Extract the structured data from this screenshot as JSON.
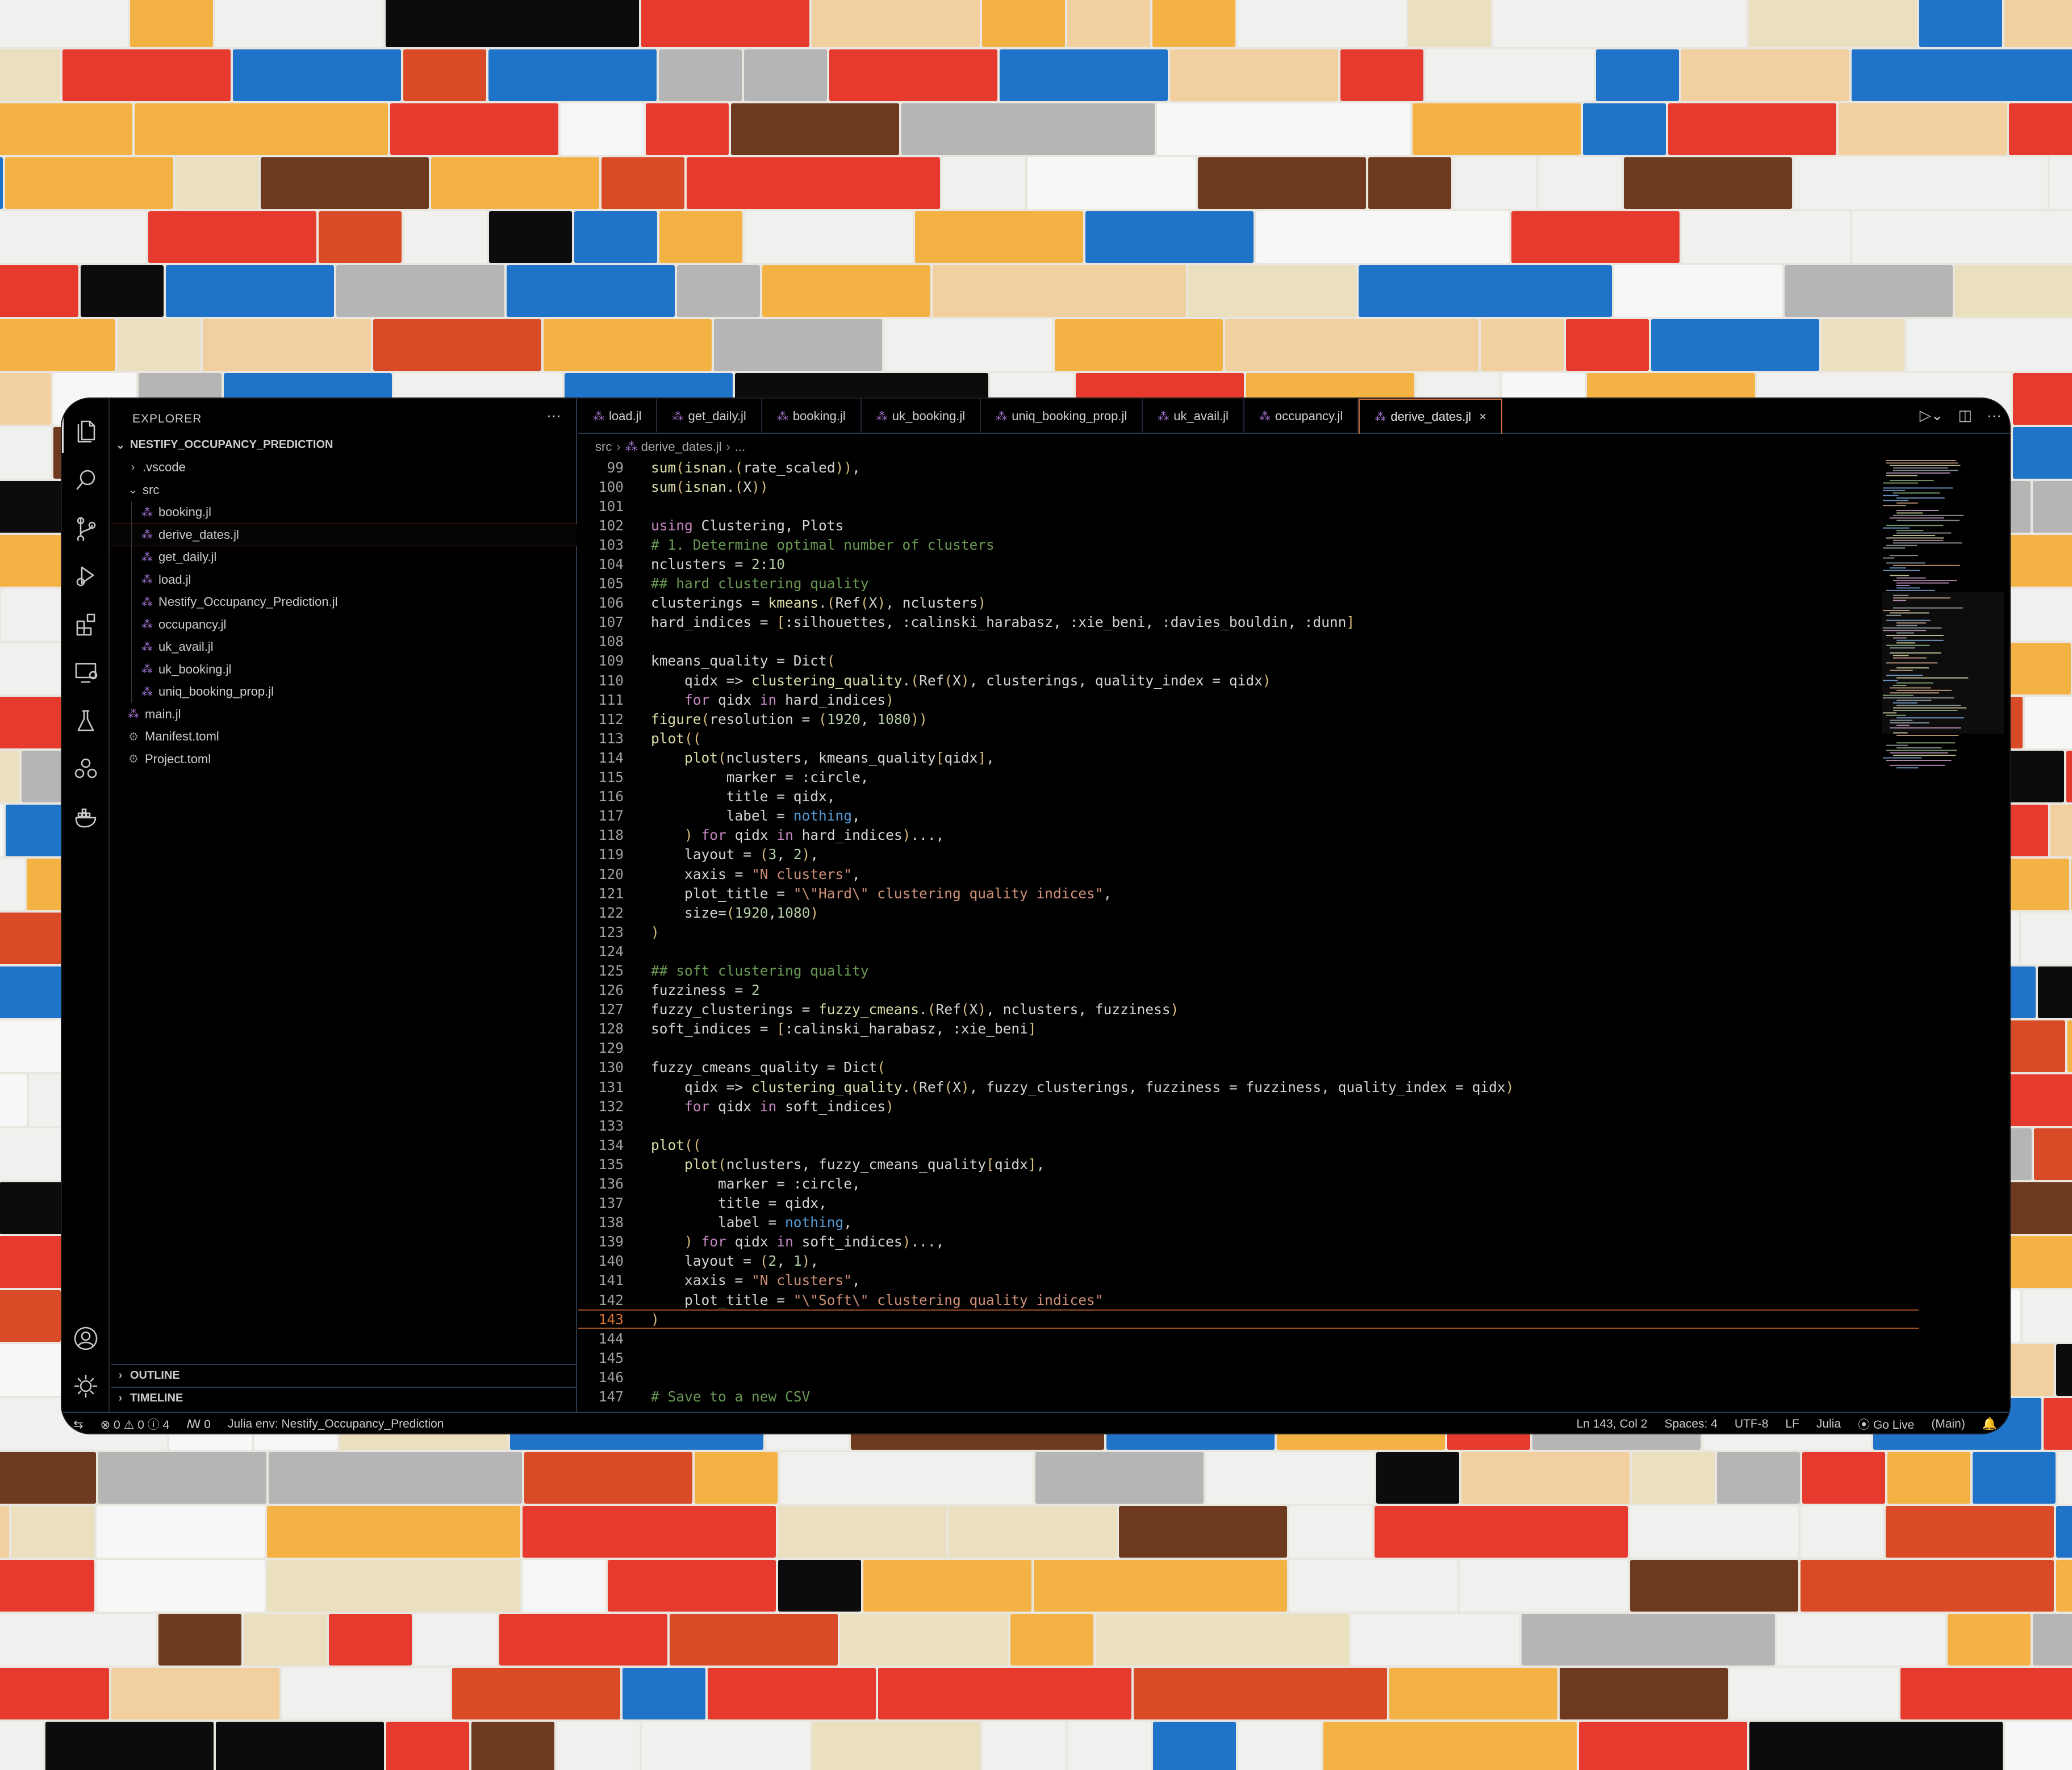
{
  "colors": {
    "accent": "#c7683a",
    "julia": "#a877d6",
    "keyword": "#c586c0",
    "function": "#dcdcaa",
    "comment": "#6a9955",
    "string": "#ce9178",
    "number": "#b5cea8",
    "constant": "#569cd6"
  },
  "activity_bar": {
    "items": [
      "files-icon",
      "search-icon",
      "source-control-icon",
      "run-debug-icon",
      "extensions-icon",
      "remote-explorer-icon",
      "testing-icon",
      "julia-icon",
      "docker-icon"
    ],
    "bottom": [
      "account-icon",
      "manage-gear-icon"
    ]
  },
  "sidebar": {
    "title": "EXPLORER",
    "more": "···",
    "project": "NESTIFY_OCCUPANCY_PREDICTION",
    "items": [
      {
        "label": ".vscode",
        "type": "folder-collapsed",
        "depth": 1
      },
      {
        "label": "src",
        "type": "folder-open",
        "depth": 1
      },
      {
        "label": "booking.jl",
        "type": "julia",
        "depth": 2
      },
      {
        "label": "derive_dates.jl",
        "type": "julia",
        "depth": 2,
        "selected": true
      },
      {
        "label": "get_daily.jl",
        "type": "julia",
        "depth": 2
      },
      {
        "label": "load.jl",
        "type": "julia",
        "depth": 2
      },
      {
        "label": "Nestify_Occupancy_Prediction.jl",
        "type": "julia",
        "depth": 2
      },
      {
        "label": "occupancy.jl",
        "type": "julia",
        "depth": 2
      },
      {
        "label": "uk_avail.jl",
        "type": "julia",
        "depth": 2
      },
      {
        "label": "uk_booking.jl",
        "type": "julia",
        "depth": 2
      },
      {
        "label": "uniq_booking_prop.jl",
        "type": "julia",
        "depth": 2
      },
      {
        "label": "main.jl",
        "type": "julia",
        "depth": 1
      },
      {
        "label": "Manifest.toml",
        "type": "toml",
        "depth": 1
      },
      {
        "label": "Project.toml",
        "type": "toml",
        "depth": 1
      }
    ],
    "outline": "OUTLINE",
    "timeline": "TIMELINE"
  },
  "tabs": [
    {
      "label": "load.jl"
    },
    {
      "label": "get_daily.jl"
    },
    {
      "label": "booking.jl"
    },
    {
      "label": "uk_booking.jl"
    },
    {
      "label": "uniq_booking_prop.jl"
    },
    {
      "label": "uk_avail.jl"
    },
    {
      "label": "occupancy.jl"
    },
    {
      "label": "derive_dates.jl",
      "active": true
    }
  ],
  "tab_close": "×",
  "breadcrumb": {
    "folder": "src",
    "file": "derive_dates.jl",
    "more": "..."
  },
  "code_lines": [
    {
      "n": "99",
      "t": "sum(isnan.(rate_scaled)),"
    },
    {
      "n": "100",
      "t": "sum(isnan.(X))"
    },
    {
      "n": "101",
      "t": ""
    },
    {
      "n": "102",
      "t": "using Clustering, Plots"
    },
    {
      "n": "103",
      "t": "# 1. Determine optimal number of clusters"
    },
    {
      "n": "104",
      "t": "nclusters = 2:10"
    },
    {
      "n": "105",
      "t": "## hard clustering quality"
    },
    {
      "n": "106",
      "t": "clusterings = kmeans.(Ref(X), nclusters)"
    },
    {
      "n": "107",
      "t": "hard_indices = [:silhouettes, :calinski_harabasz, :xie_beni, :davies_bouldin, :dunn]"
    },
    {
      "n": "108",
      "t": ""
    },
    {
      "n": "109",
      "t": "kmeans_quality = Dict("
    },
    {
      "n": "110",
      "t": "    qidx => clustering_quality.(Ref(X), clusterings, quality_index = qidx)"
    },
    {
      "n": "111",
      "t": "    for qidx in hard_indices)"
    },
    {
      "n": "112",
      "t": "figure(resolution = (1920, 1080))"
    },
    {
      "n": "113",
      "t": "plot(("
    },
    {
      "n": "114",
      "t": "    plot(nclusters, kmeans_quality[qidx],"
    },
    {
      "n": "115",
      "t": "         marker = :circle,"
    },
    {
      "n": "116",
      "t": "         title = qidx,"
    },
    {
      "n": "117",
      "t": "         label = nothing,"
    },
    {
      "n": "118",
      "t": "    ) for qidx in hard_indices)...,"
    },
    {
      "n": "119",
      "t": "    layout = (3, 2),"
    },
    {
      "n": "120",
      "t": "    xaxis = \"N clusters\","
    },
    {
      "n": "121",
      "t": "    plot_title = \"\\\"Hard\\\" clustering quality indices\","
    },
    {
      "n": "122",
      "t": "    size=(1920,1080)"
    },
    {
      "n": "123",
      "t": ")"
    },
    {
      "n": "124",
      "t": ""
    },
    {
      "n": "125",
      "t": "## soft clustering quality"
    },
    {
      "n": "126",
      "t": "fuzziness = 2"
    },
    {
      "n": "127",
      "t": "fuzzy_clusterings = fuzzy_cmeans.(Ref(X), nclusters, fuzziness)"
    },
    {
      "n": "128",
      "t": "soft_indices = [:calinski_harabasz, :xie_beni]"
    },
    {
      "n": "129",
      "t": ""
    },
    {
      "n": "130",
      "t": "fuzzy_cmeans_quality = Dict("
    },
    {
      "n": "131",
      "t": "    qidx => clustering_quality.(Ref(X), fuzzy_clusterings, fuzziness = fuzziness, quality_index = qidx)"
    },
    {
      "n": "132",
      "t": "    for qidx in soft_indices)"
    },
    {
      "n": "133",
      "t": ""
    },
    {
      "n": "134",
      "t": "plot(("
    },
    {
      "n": "135",
      "t": "    plot(nclusters, fuzzy_cmeans_quality[qidx],"
    },
    {
      "n": "136",
      "t": "        marker = :circle,"
    },
    {
      "n": "137",
      "t": "        title = qidx,"
    },
    {
      "n": "138",
      "t": "        label = nothing,"
    },
    {
      "n": "139",
      "t": "    ) for qidx in soft_indices)...,"
    },
    {
      "n": "140",
      "t": "    layout = (2, 1),"
    },
    {
      "n": "141",
      "t": "    xaxis = \"N clusters\","
    },
    {
      "n": "142",
      "t": "    plot_title = \"\\\"Soft\\\" clustering quality indices\""
    },
    {
      "n": "143",
      "t": ")"
    },
    {
      "n": "144",
      "t": ""
    },
    {
      "n": "145",
      "t": ""
    },
    {
      "n": "146",
      "t": ""
    },
    {
      "n": "147",
      "t": "# Save to a new CSV"
    }
  ],
  "current_line": "143",
  "status_bar": {
    "remote": "⇆",
    "errors": "⊗ 0",
    "warnings": "⚠ 0",
    "infos": "ⓘ 4",
    "ports": "ꟿ 0",
    "julia_env": "Julia env: Nestify_Occupancy_Prediction",
    "position": "Ln 143, Col 2",
    "spaces": "Spaces: 4",
    "encoding": "UTF-8",
    "eol": "LF",
    "language": "Julia",
    "go_live": "⦿ Go Live",
    "branch": "(Main)",
    "bell": "🔔"
  }
}
